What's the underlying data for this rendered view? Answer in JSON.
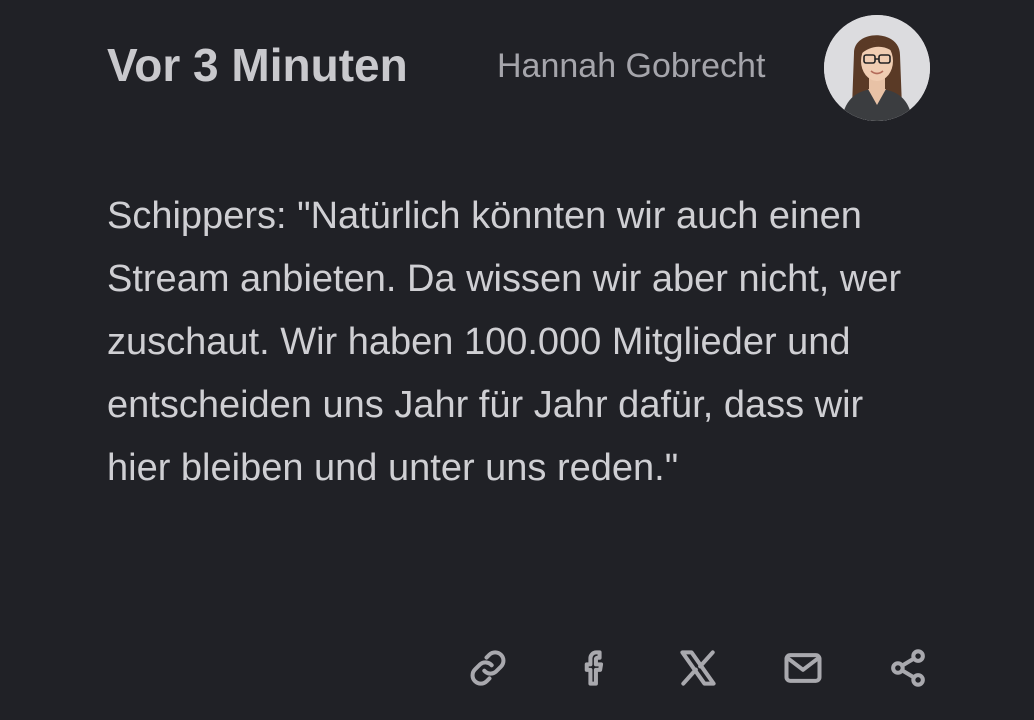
{
  "entry": {
    "time_label": "Vor 3 Minuten",
    "author_name": "Hannah Gobrecht",
    "avatar_icon": "author-portrait",
    "text": "Schippers: \"Natürlich könnten wir auch einen Stream anbieten. Da wissen wir aber nicht, wer zuschaut. Wir haben 100.000 Mitglieder und entscheiden uns Jahr für Jahr dafür, dass wir hier bleiben und unter uns reden.\""
  },
  "share": {
    "icons": [
      "link-icon",
      "facebook-icon",
      "x-icon",
      "mail-icon",
      "share-icon"
    ]
  },
  "colors": {
    "background": "#202126",
    "text": "#cfcfd3",
    "muted": "#a5a5ab"
  }
}
